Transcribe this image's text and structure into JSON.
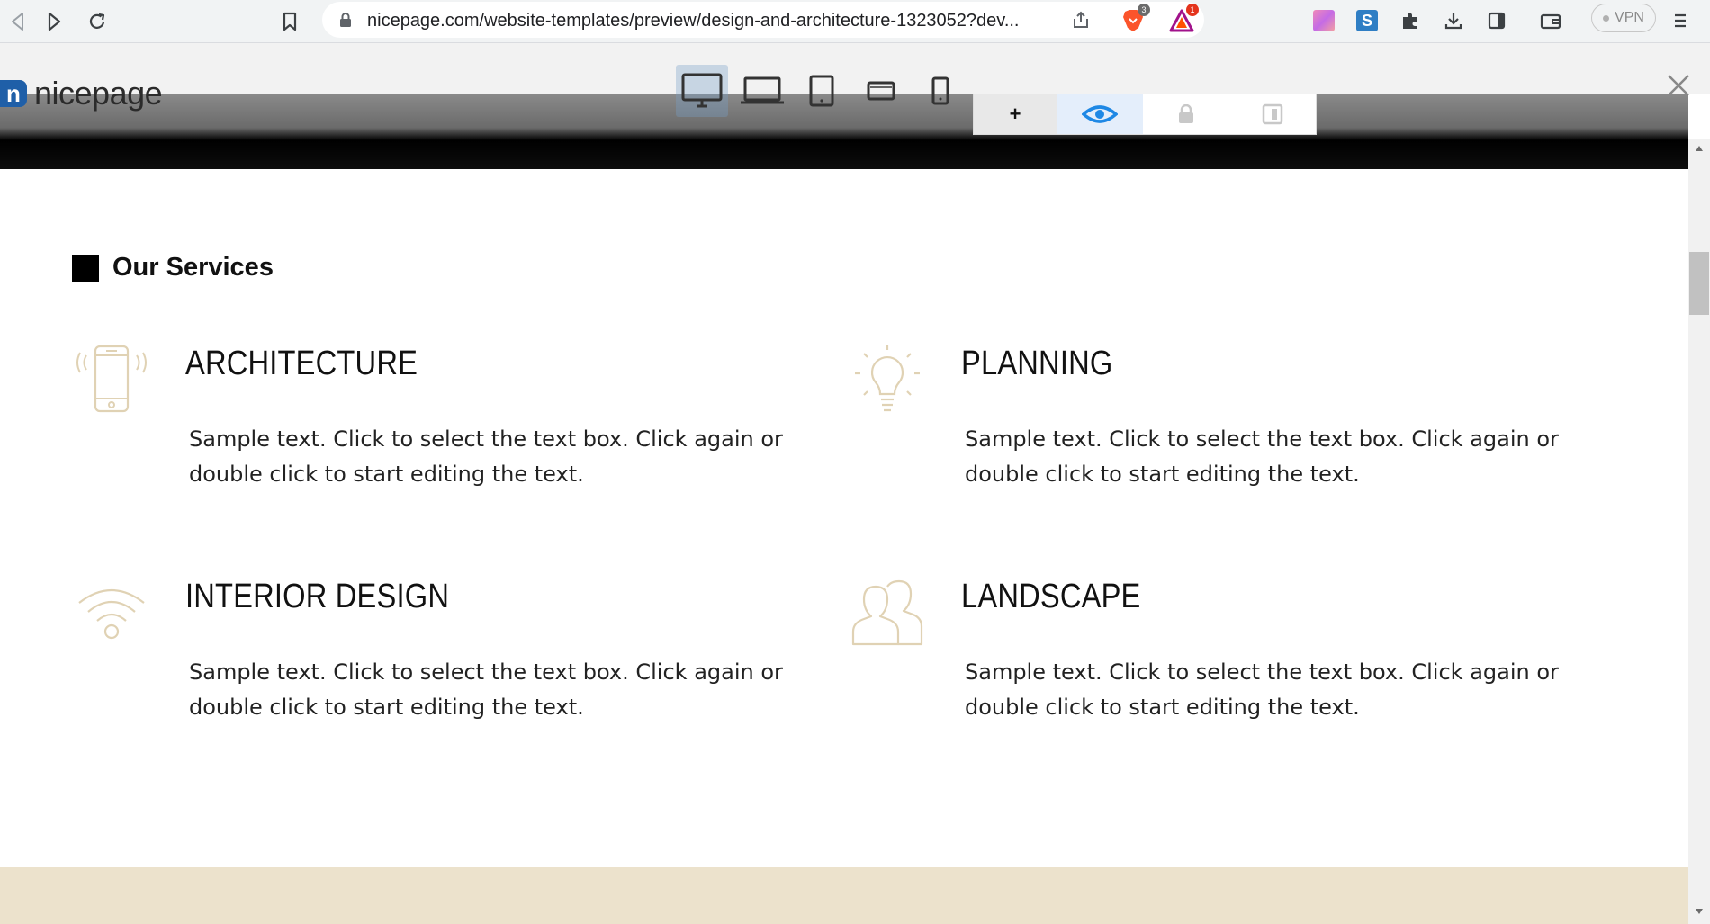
{
  "browser": {
    "url": "nicepage.com/website-templates/preview/design-and-architecture-1323052?dev...",
    "vpn_label": "VPN",
    "brave_badge": "3",
    "rewards_badge": "1"
  },
  "preview_toolbar": {
    "logo_text": "nicepage",
    "logo_mark": "n",
    "devices": [
      "desktop-icon",
      "laptop-icon",
      "tablet-icon",
      "tablet-landscape-icon",
      "phone-icon"
    ],
    "active_device": "desktop-icon",
    "mode_add_label": "+"
  },
  "services": {
    "heading": "Our Services",
    "items": [
      {
        "title": "ARCHITECTURE",
        "icon": "phone-icon",
        "desc": "Sample text. Click to select the text box. Click again or double click to start editing the text."
      },
      {
        "title": "PLANNING",
        "icon": "lightbulb-icon",
        "desc": "Sample text. Click to select the text box. Click again or double click to start editing the text."
      },
      {
        "title": "INTERIOR DESIGN",
        "icon": "wifi-icon",
        "desc": "Sample text. Click to select the text box. Click again or double click to start editing the text."
      },
      {
        "title": "LANDSCAPE",
        "icon": "users-icon",
        "desc": "Sample text. Click to select the text box. Click again or double click to start editing the text."
      }
    ]
  },
  "colors": {
    "accent_icon": "#e0d2b4",
    "footer_band": "#ece2cc",
    "heading_square": "#000000"
  }
}
